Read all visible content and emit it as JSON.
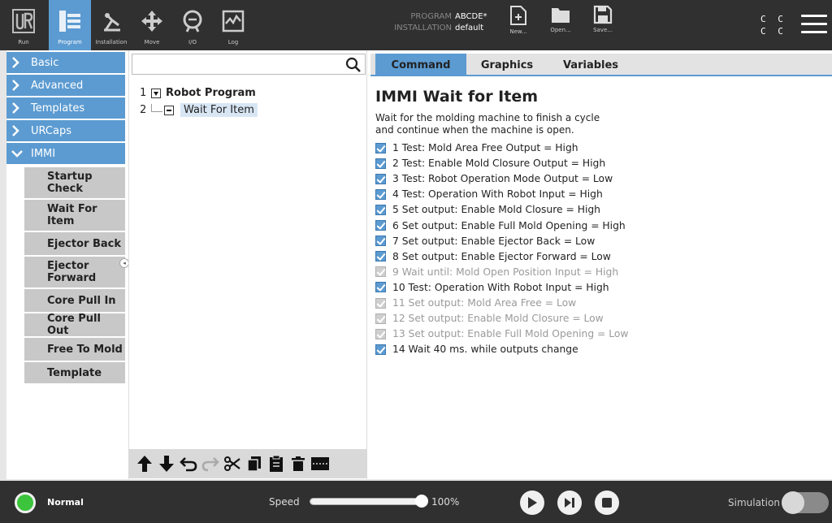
{
  "header": {
    "nav": [
      {
        "label": "Run",
        "icon": "ur-logo-icon"
      },
      {
        "label": "Program",
        "icon": "program-icon"
      },
      {
        "label": "Installation",
        "icon": "installation-icon"
      },
      {
        "label": "Move",
        "icon": "move-icon"
      },
      {
        "label": "I/O",
        "icon": "io-icon"
      },
      {
        "label": "Log",
        "icon": "log-icon"
      }
    ],
    "program_key": "PROGRAM",
    "program_val": "ABCDE*",
    "installation_key": "INSTALLATION",
    "installation_val": "default",
    "file_buttons": [
      {
        "label": "New...",
        "icon": "new-file-icon"
      },
      {
        "label": "Open...",
        "icon": "open-folder-icon"
      },
      {
        "label": "Save...",
        "icon": "save-icon"
      }
    ],
    "cc_line1": "C C",
    "cc_line2": "C C"
  },
  "sidebar": {
    "categories": [
      "Basic",
      "Advanced",
      "Templates",
      "URCaps",
      "IMMI"
    ],
    "immi_items": [
      "Startup Check",
      "Wait For Item",
      "Ejector Back",
      "Ejector Forward",
      "Core Pull In",
      "Core Pull Out",
      "Free To Mold",
      "Template"
    ]
  },
  "tree": {
    "search_placeholder": "",
    "lines": [
      {
        "num": "1",
        "label": "Robot Program"
      },
      {
        "num": "2",
        "label": "Wait For Item"
      }
    ]
  },
  "tabs": [
    "Command",
    "Graphics",
    "Variables"
  ],
  "command": {
    "title": "IMMI Wait for Item",
    "description_1": "Wait for the molding machine to finish a cycle",
    "description_2": "and continue when the machine is open.",
    "items": [
      {
        "text": "1 Test: Mold Area Free Output = High",
        "enabled": true
      },
      {
        "text": "2 Test: Enable Mold Closure Output = High",
        "enabled": true
      },
      {
        "text": "3 Test: Robot Operation Mode Output = Low",
        "enabled": true
      },
      {
        "text": "4 Test: Operation With Robot Input = High",
        "enabled": true
      },
      {
        "text": "5 Set output: Enable Mold Closure = High",
        "enabled": true
      },
      {
        "text": "6 Set output: Enable Full Mold Opening = High",
        "enabled": true
      },
      {
        "text": "7 Set output: Enable Ejector Back = Low",
        "enabled": true
      },
      {
        "text": "8 Set output: Enable Ejector Forward = Low",
        "enabled": true
      },
      {
        "text": "9 Wait until: Mold Open Position Input = High",
        "enabled": false
      },
      {
        "text": "10 Test: Operation With Robot Input = High",
        "enabled": true
      },
      {
        "text": "11 Set output: Mold Area Free = Low",
        "enabled": false
      },
      {
        "text": "12 Set output: Enable Mold Closure = Low",
        "enabled": false
      },
      {
        "text": "13 Set output: Enable Full Mold Opening = Low",
        "enabled": false
      },
      {
        "text": "14 Wait 40 ms. while outputs change",
        "enabled": true
      }
    ]
  },
  "footer": {
    "status": "Normal",
    "speed_label": "Speed",
    "speed_value": "100%",
    "speed_fraction": 1.0,
    "simulation_label": "Simulation"
  },
  "colors": {
    "accent": "#5c9bd1",
    "header_bg": "#303030",
    "status_ok": "#3cc43c"
  }
}
